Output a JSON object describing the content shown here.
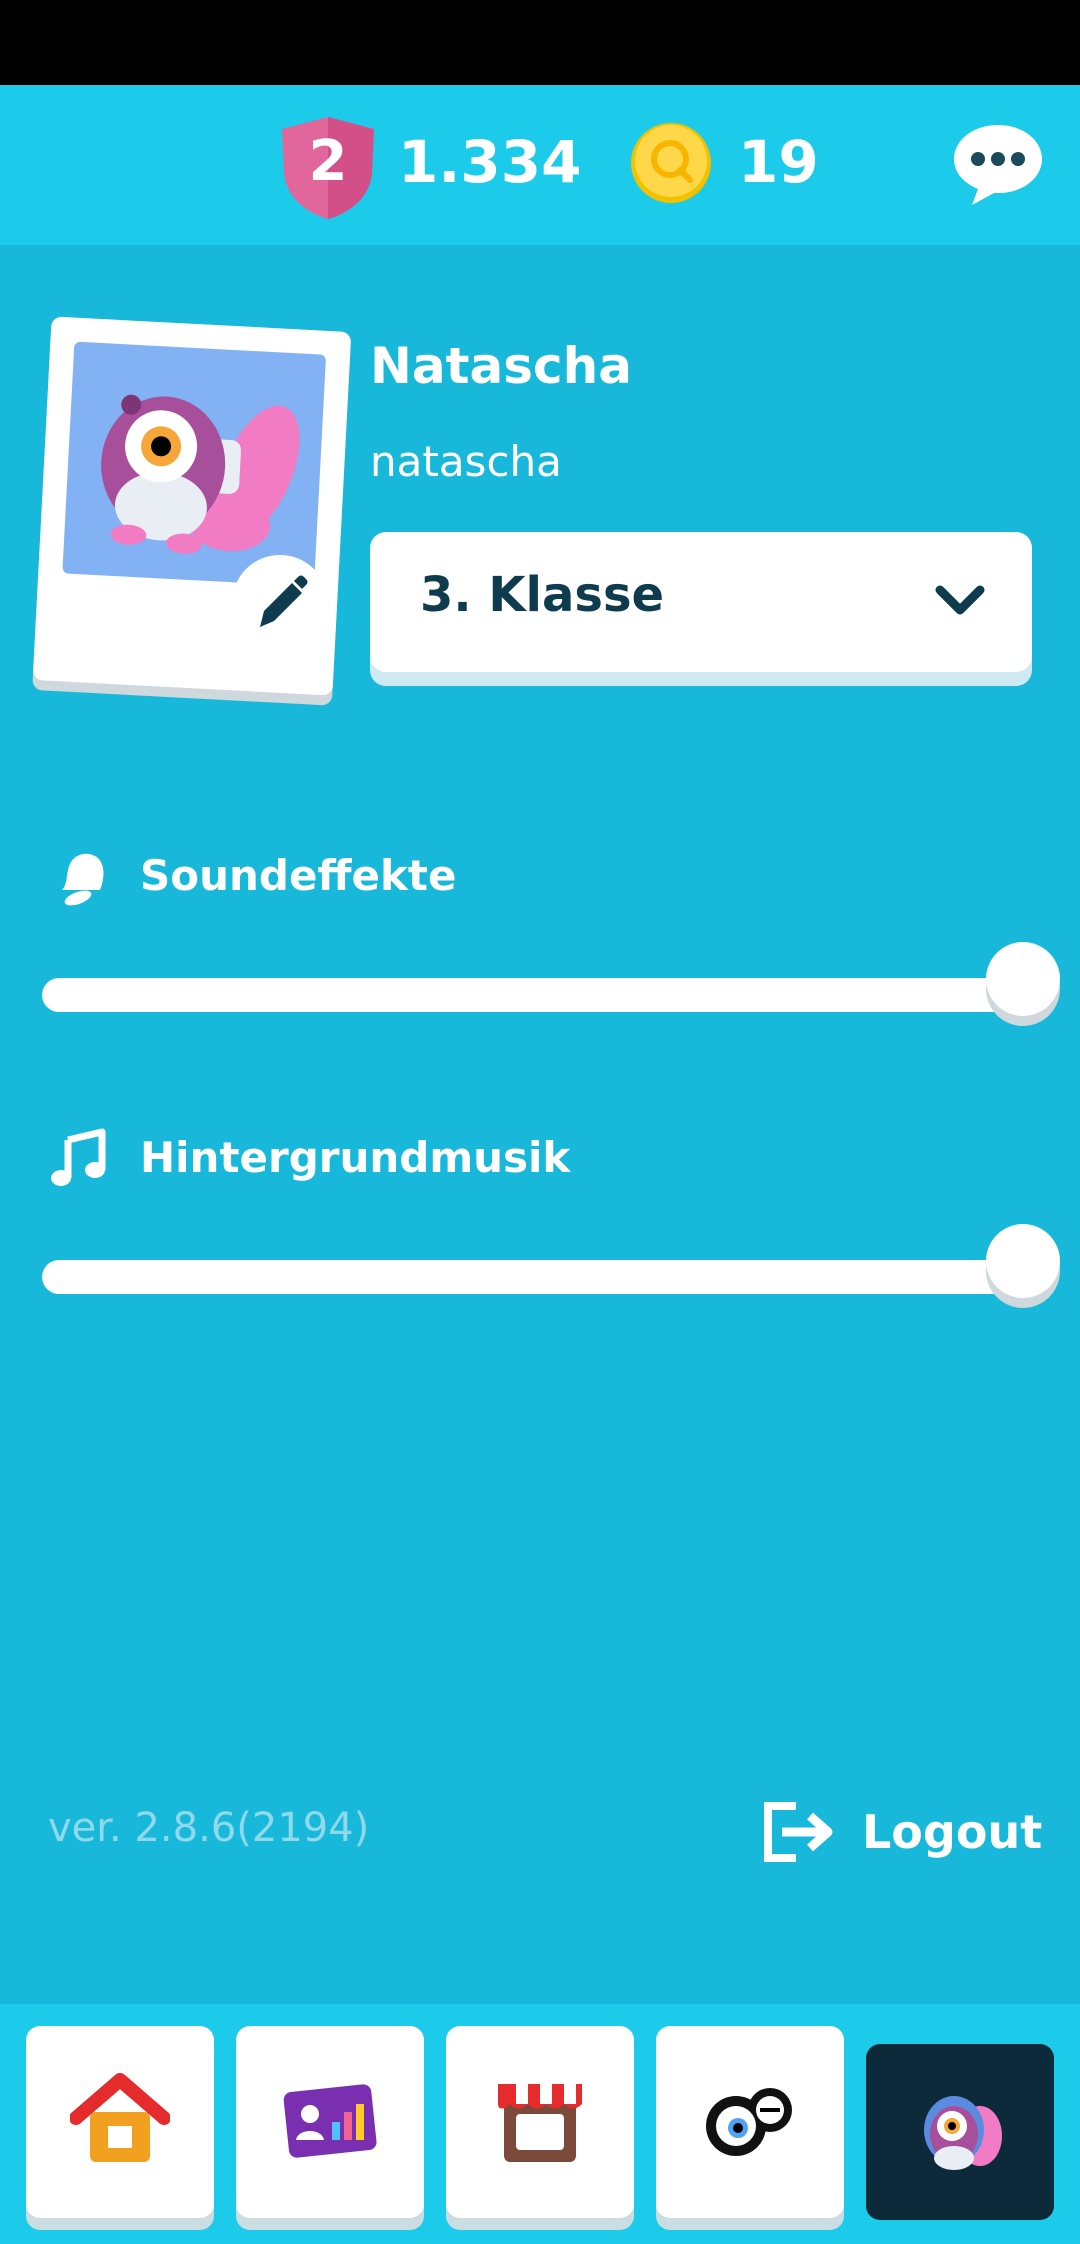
{
  "top_bar": {
    "league_level": "2",
    "trophies": "1.334",
    "coins": "19"
  },
  "profile": {
    "display_name": "Natascha",
    "username": "natascha",
    "grade": "3. Klasse"
  },
  "settings": {
    "sound_effects_label": "Soundeffekte",
    "sound_effects_level": 1.0,
    "background_music_label": "Hintergrundmusik",
    "background_music_level": 1.0
  },
  "footer": {
    "version": "ver. 2.8.6(2194)",
    "logout_label": "Logout"
  },
  "bottom_nav": {
    "items": [
      {
        "name": "home",
        "icon": "house-icon"
      },
      {
        "name": "stats",
        "icon": "stats-card-icon"
      },
      {
        "name": "shop",
        "icon": "shop-icon"
      },
      {
        "name": "monsters",
        "icon": "monster-eyes-icon"
      },
      {
        "name": "profile",
        "icon": "avatar-icon",
        "active": true
      }
    ]
  },
  "colors": {
    "background": "#18b8da",
    "top_bar": "#1ccbea",
    "shield": "#e0669b",
    "coin": "#ffd400",
    "dark_text": "#0f3b4f",
    "active_nav": "#0d2a3a"
  }
}
